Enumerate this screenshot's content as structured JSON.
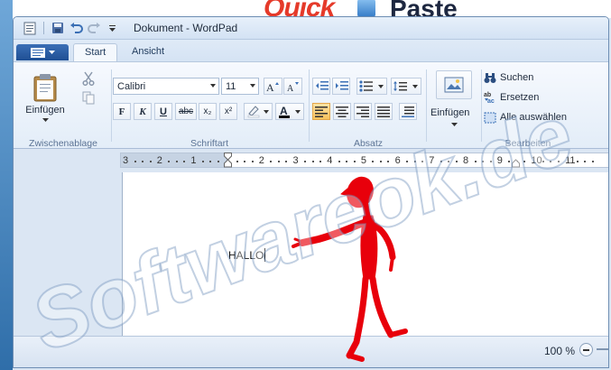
{
  "banner": {
    "quick": "Quick",
    "paste": "Paste"
  },
  "window": {
    "title": "Dokument - WordPad"
  },
  "tabs": [
    {
      "label": "Start",
      "active": true
    },
    {
      "label": "Ansicht",
      "active": false
    }
  ],
  "ribbon": {
    "clipboard": {
      "paste_label": "Einfügen",
      "group_label": "Zwischenablage"
    },
    "font": {
      "family": "Calibri",
      "size": "11",
      "bold": "F",
      "italic": "K",
      "underline": "U",
      "strike": "abc",
      "subscript": "x₂",
      "superscript": "x²",
      "group_label": "Schriftart"
    },
    "paragraph": {
      "group_label": "Absatz"
    },
    "insert": {
      "label": "Einfügen"
    },
    "editing": {
      "find": "Suchen",
      "replace": "Ersetzen",
      "select_all": "Alle auswählen",
      "group_label": "Bearbeiten"
    }
  },
  "ruler": {
    "labels": [
      "3",
      "2",
      "1",
      "1",
      "2",
      "3",
      "4",
      "5",
      "6",
      "7",
      "8",
      "9",
      "10",
      "11"
    ]
  },
  "document": {
    "text": "HALLO"
  },
  "status": {
    "zoom": "100 %"
  },
  "watermark": {
    "text": "Softwareok.de"
  },
  "colors": {
    "accent": "#e53a2a",
    "selected": "#f7c25d",
    "stickman": "#e8000b"
  }
}
